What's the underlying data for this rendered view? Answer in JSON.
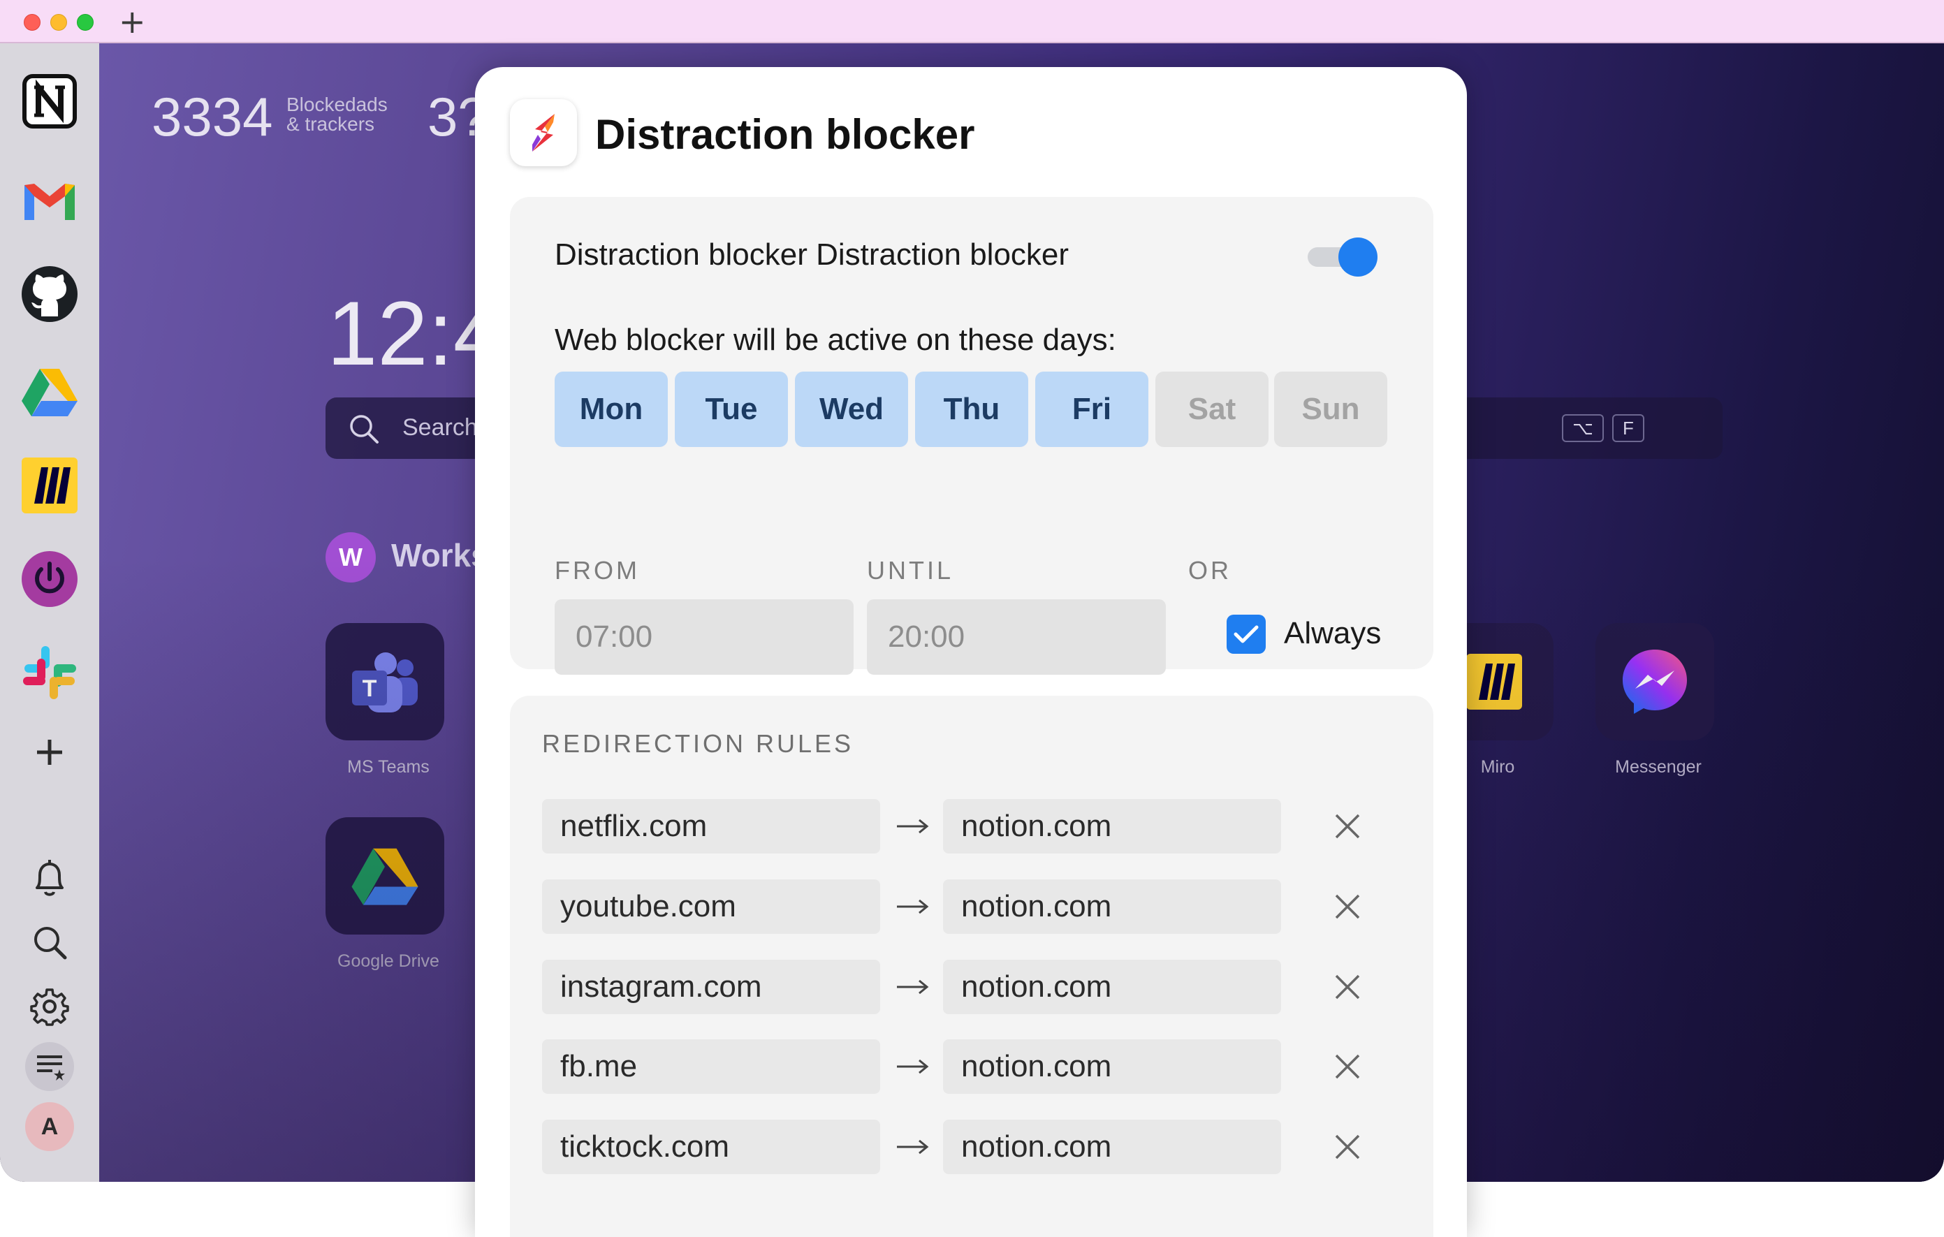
{
  "titlebar": {
    "new_tab_label": "+"
  },
  "dock": {
    "apps": [
      {
        "name": "notion-icon"
      },
      {
        "name": "gmail-icon"
      },
      {
        "name": "github-icon"
      },
      {
        "name": "google-drive-icon"
      },
      {
        "name": "miro-icon"
      },
      {
        "name": "power-icon"
      },
      {
        "name": "slack-icon"
      },
      {
        "name": "add-app-icon"
      }
    ],
    "tools": [
      {
        "name": "bell-icon"
      },
      {
        "name": "search-icon"
      },
      {
        "name": "gear-icon"
      },
      {
        "name": "list-star-icon"
      }
    ],
    "avatar_letter": "A"
  },
  "background": {
    "stat1_value": "3334",
    "stat1_label_line1": "Blockedads",
    "stat1_label_line2": "& trackers",
    "stat2_value": "3?",
    "clock": "12:4",
    "search_placeholder": "Search",
    "shortcut_keys": [
      "⌥",
      "F"
    ],
    "workspace_badge": "W",
    "workspace_name": "Works",
    "apps": [
      {
        "label": "MS Teams"
      },
      {
        "label": "Google Drive"
      },
      {
        "label": "Miro"
      },
      {
        "label": "Messenger"
      }
    ]
  },
  "modal": {
    "title": "Distraction blocker",
    "blocker_label": "Distraction blocker Distraction blocker",
    "blocker_enabled": true,
    "days_label": "Web blocker will be active on these days:",
    "days": [
      {
        "label": "Mon",
        "active": true
      },
      {
        "label": "Tue",
        "active": true
      },
      {
        "label": "Wed",
        "active": true
      },
      {
        "label": "Thu",
        "active": true
      },
      {
        "label": "Fri",
        "active": true
      },
      {
        "label": "Sat",
        "active": false
      },
      {
        "label": "Sun",
        "active": false
      }
    ],
    "from_label": "FROM",
    "until_label": "UNTIL",
    "or_label": "OR",
    "from_value": "07:00",
    "until_value": "20:00",
    "always_label": "Always",
    "always_checked": true,
    "rules_title": "REDIRECTION RULES",
    "rules": [
      {
        "from": "netflix.com",
        "to": "notion.com"
      },
      {
        "from": "youtube.com",
        "to": "notion.com"
      },
      {
        "from": "instagram.com",
        "to": "notion.com"
      },
      {
        "from": "fb.me",
        "to": "notion.com"
      },
      {
        "from": "ticktock.com",
        "to": "notion.com"
      }
    ]
  },
  "colors": {
    "accent": "#1f7ef0",
    "day_active_bg": "#bcd8f7",
    "day_inactive_bg": "#e3e3e3"
  }
}
